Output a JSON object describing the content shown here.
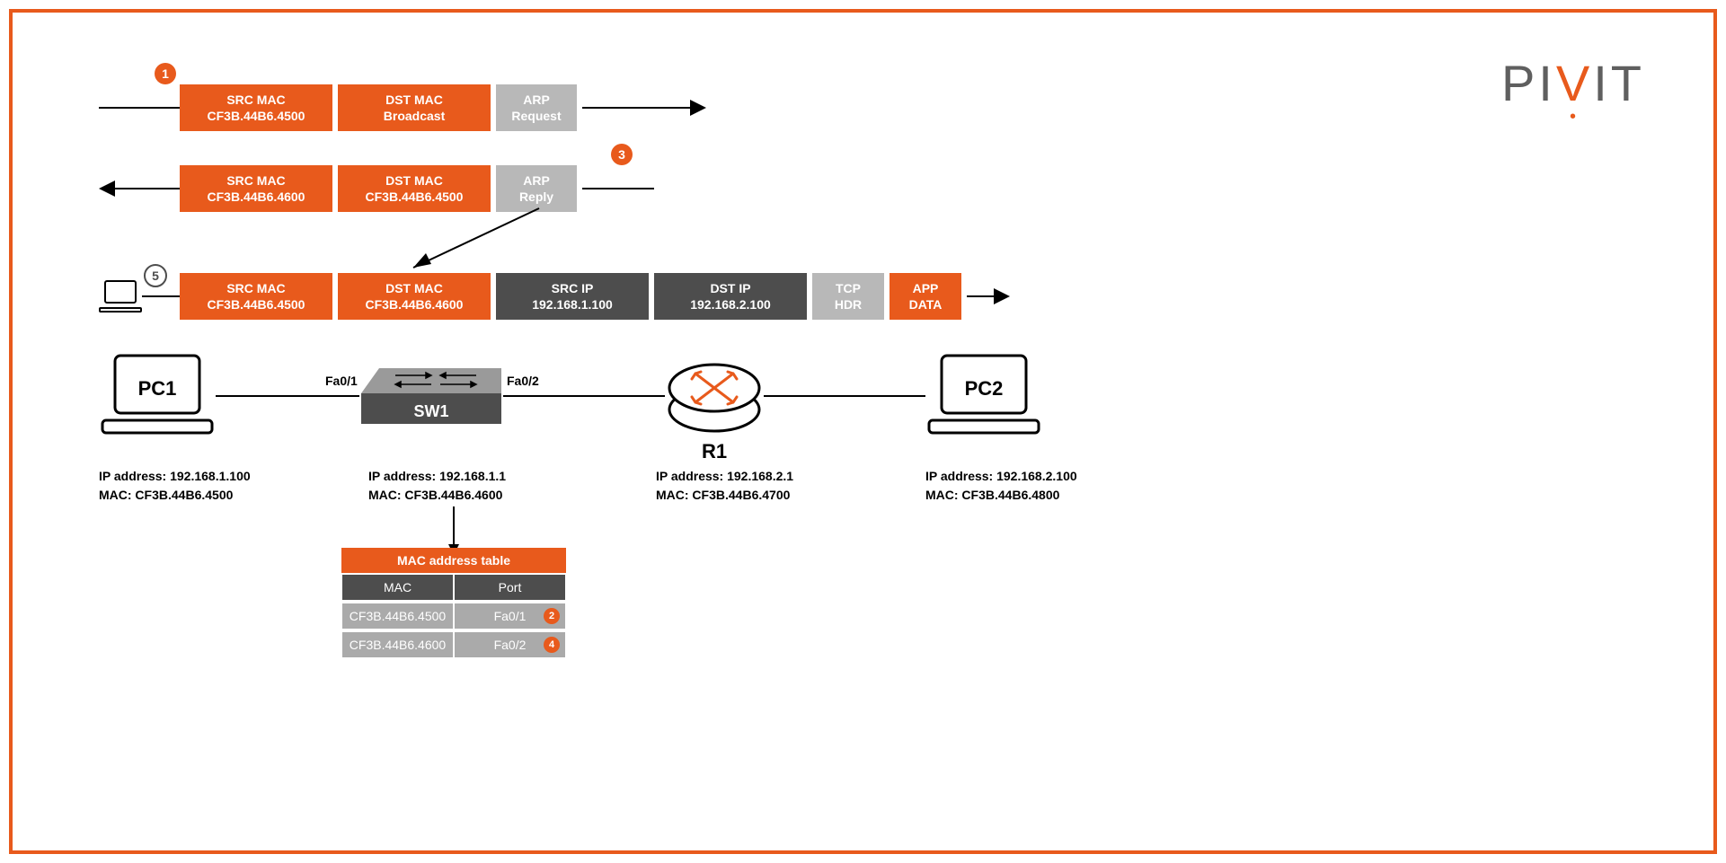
{
  "logo": {
    "text_prefix": "PI",
    "text_v": "V",
    "text_suffix": "IT"
  },
  "steps": {
    "s1": "1",
    "s2": "2",
    "s3": "3",
    "s4": "4",
    "s5": "5"
  },
  "row1": {
    "b1_l1": "SRC MAC",
    "b1_l2": "CF3B.44B6.4500",
    "b2_l1": "DST MAC",
    "b2_l2": "Broadcast",
    "b3_l1": "ARP",
    "b3_l2": "Request"
  },
  "row2": {
    "b1_l1": "SRC MAC",
    "b1_l2": "CF3B.44B6.4600",
    "b2_l1": "DST MAC",
    "b2_l2": "CF3B.44B6.4500",
    "b3_l1": "ARP",
    "b3_l2": "Reply"
  },
  "row3": {
    "b1_l1": "SRC MAC",
    "b1_l2": "CF3B.44B6.4500",
    "b2_l1": "DST MAC",
    "b2_l2": "CF3B.44B6.4600",
    "b3_l1": "SRC IP",
    "b3_l2": "192.168.1.100",
    "b4_l1": "DST IP",
    "b4_l2": "192.168.2.100",
    "b5_l1": "TCP",
    "b5_l2": "HDR",
    "b6_l1": "APP",
    "b6_l2": "DATA"
  },
  "topo": {
    "pc1": {
      "name": "PC1",
      "ip": "IP address: 192.168.1.100",
      "mac": "MAC: CF3B.44B6.4500"
    },
    "sw1": {
      "name": "SW1",
      "p1": "Fa0/1",
      "p2": "Fa0/2",
      "ip": "IP address: 192.168.1.1",
      "mac": "MAC: CF3B.44B6.4600"
    },
    "r1": {
      "name": "R1",
      "ip": "IP address: 192.168.2.1",
      "mac": "MAC: CF3B.44B6.4700"
    },
    "pc2": {
      "name": "PC2",
      "ip": "IP address: 192.168.2.100",
      "mac": "MAC: CF3B.44B6.4800"
    }
  },
  "mac_table": {
    "title": "MAC address table",
    "col1": "MAC",
    "col2": "Port",
    "rows": [
      {
        "mac": "CF3B.44B6.4500",
        "port": "Fa0/1",
        "step": "2"
      },
      {
        "mac": "CF3B.44B6.4600",
        "port": "Fa0/2",
        "step": "4"
      }
    ]
  }
}
